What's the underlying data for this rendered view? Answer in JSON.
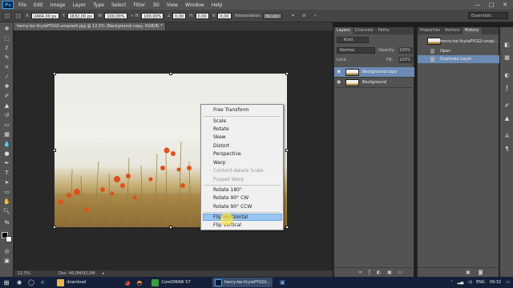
{
  "app": {
    "logo": "Ps"
  },
  "menubar": {
    "items": [
      "File",
      "Edit",
      "Image",
      "Layer",
      "Type",
      "Select",
      "Filter",
      "3D",
      "View",
      "Window",
      "Help"
    ],
    "minimize": "—",
    "maximize": "□",
    "close": "✕"
  },
  "options": {
    "x_label": "X:",
    "x_value": "2464,00 px",
    "y_label": "Y:",
    "y_value": "1632,00 px",
    "w_label": "W:",
    "w_value": "100,00%",
    "h_label": "H:",
    "h_value": "100,00%",
    "angle_value": "0,00",
    "hskew_label": "H:",
    "hskew_value": "0,00",
    "vskew_label": "V:",
    "vskew_value": "0,00",
    "interp_label": "Interpolation:",
    "interp_value": "Bicubic",
    "workspace": "Essentials"
  },
  "document": {
    "tab_title": "henry-be-lIcyiaPYGGI-unsplash.jpg @ 12,5% (Background copy, RGB/8) *",
    "zoom": "12,5%",
    "doc_size": "Doc: 46,0M/92,0M"
  },
  "context_menu": {
    "items": [
      {
        "label": "Free Transform",
        "enabled": true
      },
      {
        "label": "Scale",
        "enabled": true
      },
      {
        "label": "Rotate",
        "enabled": true
      },
      {
        "label": "Skew",
        "enabled": true
      },
      {
        "label": "Distort",
        "enabled": true
      },
      {
        "label": "Perspective",
        "enabled": true
      },
      {
        "label": "Warp",
        "enabled": true
      },
      {
        "label": "Content-Aware Scale",
        "enabled": false
      },
      {
        "label": "Puppet Warp",
        "enabled": false
      },
      {
        "label": "Rotate 180°",
        "enabled": true
      },
      {
        "label": "Rotate 90° CW",
        "enabled": true
      },
      {
        "label": "Rotate 90° CCW",
        "enabled": true
      },
      {
        "label": "Flip Horizontal",
        "enabled": true,
        "highlighted": true
      },
      {
        "label": "Flip Vertical",
        "enabled": true
      }
    ]
  },
  "layers_panel": {
    "tabs": [
      "Layers",
      "Channels",
      "Paths"
    ],
    "kind_label": "Kind",
    "blend_mode": "Normal",
    "opacity_label": "Opacity:",
    "opacity_value": "100%",
    "lock_label": "Lock:",
    "fill_label": "Fill:",
    "fill_value": "100%",
    "layers": [
      {
        "name": "Background copy",
        "selected": true
      },
      {
        "name": "Background",
        "selected": false
      }
    ]
  },
  "history_panel": {
    "tabs": [
      "Properties",
      "Actions",
      "History"
    ],
    "snapshot_name": "henry-be-lIcyiaPYGGI-unspl...",
    "states": [
      {
        "name": "Open",
        "selected": false
      },
      {
        "name": "Duplicate Layer",
        "selected": true
      }
    ]
  },
  "taskbar": {
    "apps": [
      {
        "label": "download",
        "color": "#e8b84a"
      },
      {
        "label": "CorelDRAW X7",
        "color": "#3c9d3c"
      },
      {
        "label": "henry-be-lIcyiaPYGGI...",
        "color": "#31a8ff"
      }
    ],
    "lang": "ENG",
    "time": "09:32"
  },
  "colors": {
    "accent": "#6b8bb5",
    "menu_highlight": "#99c5f0",
    "poppy": "#e0501e"
  }
}
